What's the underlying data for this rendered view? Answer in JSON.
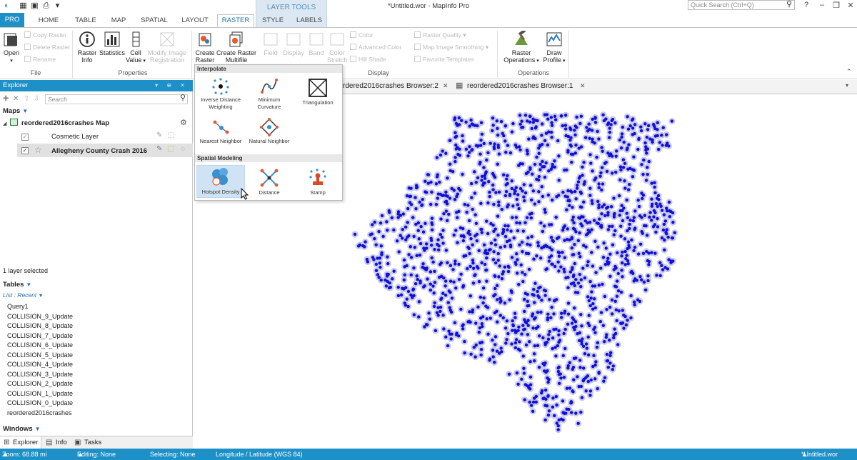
{
  "window": {
    "title": "*Untitled.wor - MapInfo Pro",
    "quick_search_placeholder": "Quick Search (Ctrl+Q)"
  },
  "ribbon_tabs": [
    "PRO",
    "HOME",
    "TABLE",
    "MAP",
    "SPATIAL",
    "LAYOUT",
    "RASTER",
    "STYLE",
    "LABELS"
  ],
  "layer_tools_label": "LAYER TOOLS",
  "ribbon": {
    "file": {
      "group": "File",
      "open": "Open",
      "copy_raster": "Copy Raster",
      "delete_raster": "Delete Raster",
      "rename": "Rename"
    },
    "properties": {
      "group": "Properties",
      "raster_info": "Raster\nInfo",
      "statistics": "Statistics",
      "cell_value": "Cell\nValue",
      "modify_image": "Modify Image\nRegistration"
    },
    "create": {
      "create_raster": "Create\nRaster",
      "create_multifile": "Create Raster\nMultifile"
    },
    "display": {
      "group": "Display",
      "field": "Field",
      "display": "Display",
      "band": "Band",
      "color_stretch": "Color\nStretch",
      "color": "Color",
      "advanced_color": "Advanced Color",
      "hill_shade": "Hill Shade",
      "raster_quality": "Raster Quality",
      "map_image_smoothing": "Map Image Smoothing",
      "favorite_templates": "Favorite Templates"
    },
    "operations": {
      "group": "Operations",
      "raster_operations": "Raster\nOperations",
      "draw_profile": "Draw\nProfile"
    }
  },
  "dropdown": {
    "interpolate_header": "Interpolate",
    "interpolate_items": [
      "Inverse Distance\nWeighting",
      "Minimum\nCurvature",
      "Triangulation",
      "Nearest Neighbor",
      "Natural Neighbor"
    ],
    "spatial_header": "Spatial Modeling",
    "spatial_items": [
      "Hotspot Density",
      "Distance",
      "Stamp"
    ]
  },
  "explorer": {
    "title": "Explorer",
    "search_placeholder": "Search",
    "maps_label": "Maps",
    "map_name": "reordered2016crashes Map",
    "layers": [
      "Cosmetic Layer",
      "Allegheny County Crash 2016"
    ],
    "layers_selected": "1 layer selected",
    "tables_label": "Tables",
    "list_label": "List : Recent",
    "tables": [
      "Query1",
      "COLLISION_9_Update",
      "COLLISION_8_Update",
      "COLLISION_7_Update",
      "COLLISION_6_Update",
      "COLLISION_5_Update",
      "COLLISION_4_Update",
      "COLLISION_3_Update",
      "COLLISION_2_Update",
      "COLLISION_1_Update",
      "COLLISION_0_Update",
      "reordered2016crashes"
    ],
    "windows_label": "Windows",
    "bottom_tabs": [
      "Explorer",
      "Info",
      "Tasks"
    ]
  },
  "doc_tabs": [
    "rdered2016crashes Browser:2",
    "reordered2016crashes Browser:1"
  ],
  "status": {
    "zoom": "Zoom: 68.88 mi",
    "editing": "Editing: None",
    "selecting": "Selecting: None",
    "projection": "Longitude / Latitude (WGS 84)",
    "workspace": "*Untitled.wor"
  },
  "colors": {
    "accent": "#1e90c8",
    "point_fill": "#1010d8",
    "point_halo": "#c9c9ee"
  }
}
